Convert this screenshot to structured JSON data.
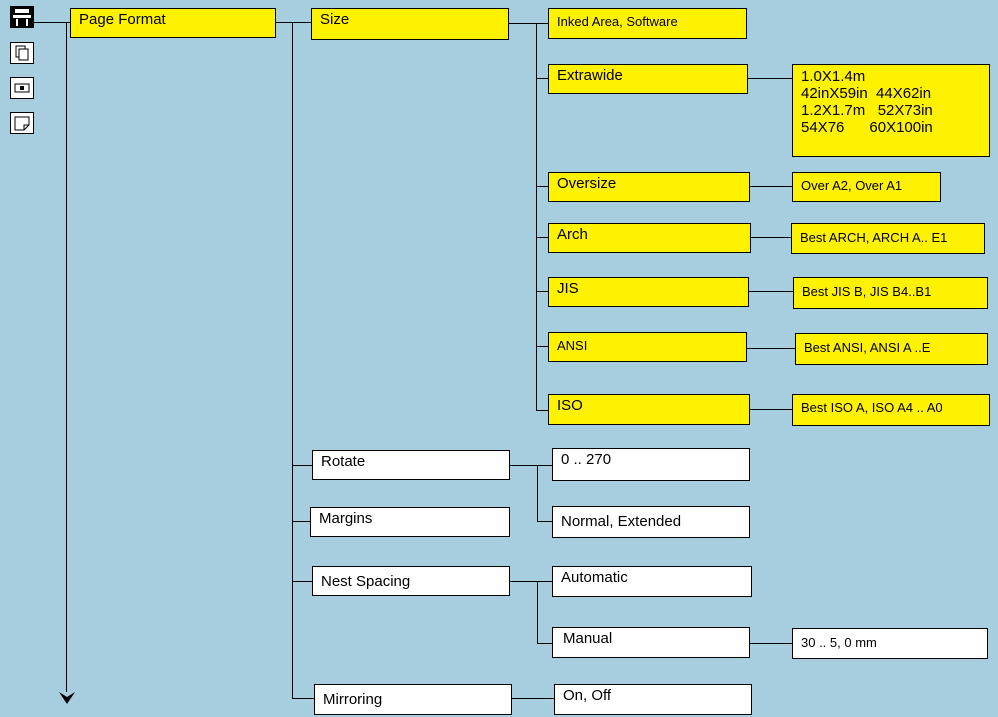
{
  "root": {
    "label": "Page Format"
  },
  "size": {
    "label": "Size",
    "options": {
      "inked": "Inked Area, Software",
      "extrawide": "Extrawide",
      "extrawide_values": "1.0X1.4m\n42inX59in  44X62in\n1.2X1.7m   52X73in\n54X76      60X100in",
      "oversize": "Oversize",
      "oversize_values": "Over A2, Over A1",
      "arch": "Arch",
      "arch_values": "Best ARCH, ARCH A.. E1",
      "jis": "JIS",
      "jis_values": "Best JIS B, JIS B4..B1",
      "ansi": "ANSI",
      "ansi_values": "Best ANSI, ANSI A ..E",
      "iso": "ISO",
      "iso_values": "Best ISO A, ISO A4 .. A0"
    }
  },
  "rotate": {
    "label": "Rotate",
    "value": "0 .. 270"
  },
  "margins": {
    "label": "Margins",
    "value": "Normal, Extended"
  },
  "nest": {
    "label": "Nest Spacing",
    "automatic": "Automatic",
    "manual": "Manual",
    "manual_value": "30 .. 5, 0 mm"
  },
  "mirroring": {
    "label": "Mirroring",
    "value": "On, Off"
  },
  "icons": [
    "plotter-icon",
    "copy-icon",
    "drive-icon",
    "page-icon"
  ],
  "colors": {
    "background": "#a6cedf",
    "highlight": "#fff200"
  }
}
